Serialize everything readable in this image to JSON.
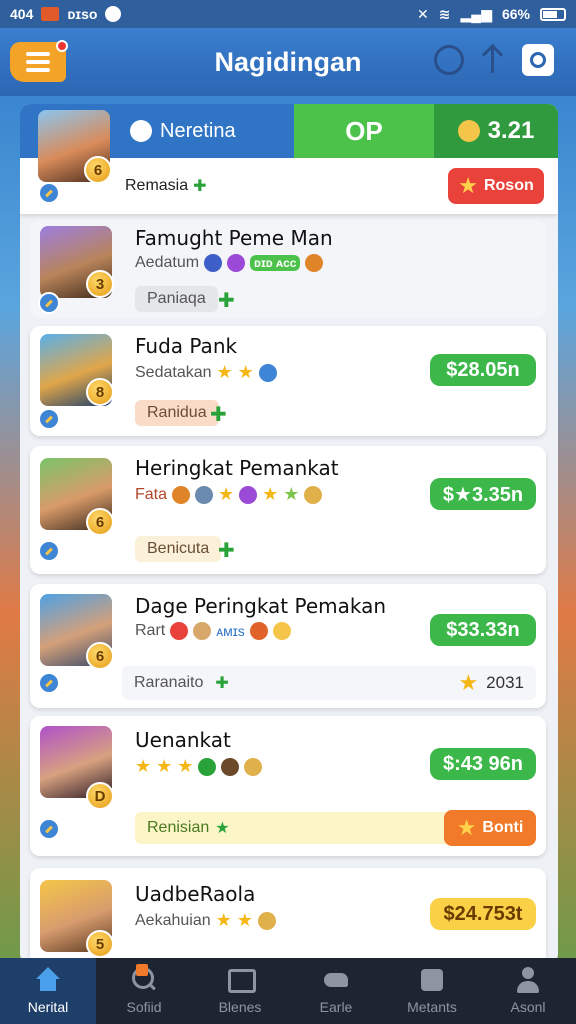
{
  "status_bar": {
    "time": "404",
    "carrier": "ᴅɪsᴏ",
    "battery": "66%"
  },
  "header": {
    "title": "Nagidingan"
  },
  "tabbar": {
    "tab1": "Neretina",
    "tab2": "OP",
    "score": "3.21"
  },
  "cards": [
    {
      "title": "",
      "sub": "Remasia",
      "button": "Roson",
      "level": "6"
    },
    {
      "title": "Famught Peme Man",
      "sub": "Aedatum",
      "sub_extra": "ᴅɪᴅ ᴀᴄᴄ",
      "tag": "Paniaqa",
      "level": "3"
    },
    {
      "title": "Fuda Pank",
      "sub": "Sedatakan",
      "tag": "Ranidua",
      "price": "$28.05n",
      "level": "8"
    },
    {
      "title": "Heringkat Pemankat",
      "sub": "Fata",
      "tag": "Benicuta",
      "price": "$★3.35n",
      "level": "6"
    },
    {
      "title": "Dage Peringkat Pemakan",
      "sub": "Rart",
      "sub_extra": "ᴀᴍɪs",
      "score_label": "Raranaito",
      "score_value": "2031",
      "price": "$33.33n",
      "level": "6"
    },
    {
      "title": "Uenankat",
      "tag": "Renisian",
      "price": "$:43 96n",
      "button": "Bonti",
      "level": "D"
    },
    {
      "title": "UadbeRaola",
      "sub": "Aekahuian",
      "price": "$24.753t",
      "level": "5"
    }
  ],
  "bottom_nav": [
    {
      "label": "Nerital",
      "active": true
    },
    {
      "label": "Sofiid"
    },
    {
      "label": "Blenes"
    },
    {
      "label": "Earle"
    },
    {
      "label": "Metants"
    },
    {
      "label": "Asonl"
    }
  ],
  "colors": {
    "accent": "#2f74c5",
    "green": "#3cb84a",
    "red": "#e8423a",
    "orange": "#f07a2a"
  }
}
